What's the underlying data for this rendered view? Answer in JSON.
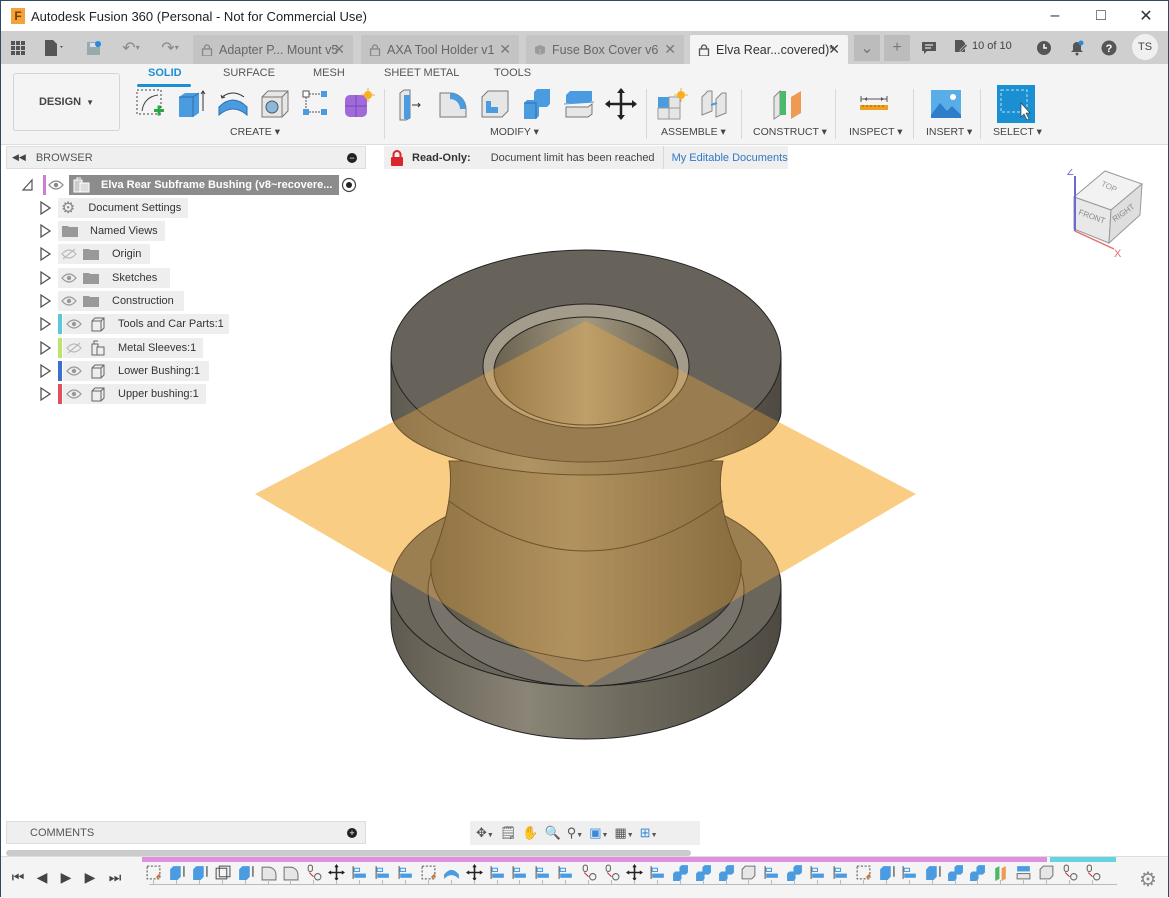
{
  "window": {
    "title": "Autodesk Fusion 360 (Personal - Not for Commercial Use)",
    "app_icon_letter": "F",
    "controls": [
      "minimize",
      "maximize",
      "close"
    ]
  },
  "tabbar": {
    "tabs": [
      {
        "label": "Adapter P... Mount v5",
        "icon": "lock-icon",
        "active": false
      },
      {
        "label": "AXA Tool Holder v1",
        "icon": "lock-icon",
        "active": false
      },
      {
        "label": "Fuse Box Cover v6",
        "icon": "cube-icon",
        "active": false
      },
      {
        "label": "Elva Rear...covered)*",
        "icon": "lock-icon",
        "active": true
      }
    ],
    "close_glyph": "✕",
    "doc_counter": "10 of 10",
    "user_initials": "TS"
  },
  "ribbon": {
    "workspace": "DESIGN",
    "tabs": [
      "SOLID",
      "SURFACE",
      "MESH",
      "SHEET METAL",
      "TOOLS"
    ],
    "active_tab": "SOLID",
    "groups": [
      "CREATE",
      "MODIFY",
      "ASSEMBLE",
      "CONSTRUCT",
      "INSPECT",
      "INSERT",
      "SELECT"
    ]
  },
  "browser": {
    "title": "BROWSER",
    "root": "Elva Rear Subframe Bushing (v8~recovere...",
    "items": [
      {
        "label": "Document Settings",
        "icon": "gear-icon",
        "visible": null,
        "color": null
      },
      {
        "label": "Named Views",
        "icon": "folder-icon",
        "visible": null,
        "color": null
      },
      {
        "label": "Origin",
        "icon": "folder-icon",
        "visible": false,
        "color": null
      },
      {
        "label": "Sketches",
        "icon": "folder-icon",
        "visible": true,
        "color": null
      },
      {
        "label": "Construction",
        "icon": "folder-icon",
        "visible": true,
        "color": null
      },
      {
        "label": "Tools and Car Parts:1",
        "icon": "component-icon",
        "visible": true,
        "color": "#5bc8d8"
      },
      {
        "label": "Metal Sleeves:1",
        "icon": "component-linked-icon",
        "visible": false,
        "color": "#bde36a"
      },
      {
        "label": "Lower Bushing:1",
        "icon": "component-icon",
        "visible": true,
        "color": "#3b6fd0"
      },
      {
        "label": "Upper bushing:1",
        "icon": "component-icon",
        "visible": true,
        "color": "#e0505a"
      }
    ]
  },
  "banner": {
    "label": "Read-Only:",
    "message": "Document limit has been reached",
    "link": "My Editable Documents"
  },
  "viewcube": {
    "faces": [
      "TOP",
      "FRONT",
      "RIGHT"
    ],
    "axes": [
      "Z",
      "X"
    ]
  },
  "comments": {
    "title": "COMMENTS"
  },
  "timeline": {
    "feature_count": 42
  },
  "colors": {
    "accent": "#1a8fd1",
    "lock_red": "#d9262b",
    "plane": "#fbd9a0",
    "body": "#6b655a"
  }
}
